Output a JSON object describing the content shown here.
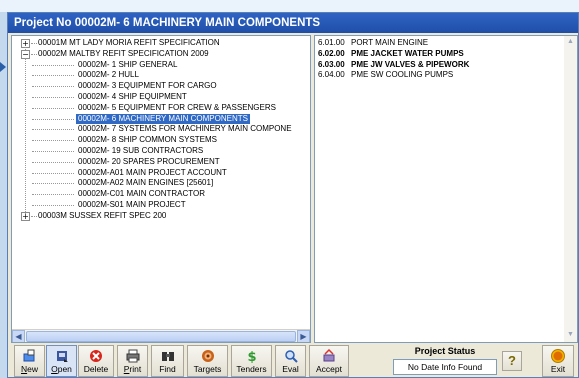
{
  "window": {
    "title": "Project No 00002M-  6  MACHINERY MAIN COMPONENTS"
  },
  "tree": {
    "nodes": [
      {
        "level": 0,
        "expander": "+",
        "label": "00001M  MT LADY MORIA REFIT SPECIFICATION"
      },
      {
        "level": 0,
        "expander": "−",
        "label": "00002M  MALTBY REFIT SPECIFICATION 2009"
      },
      {
        "level": 1,
        "label": "00002M-  1  SHIP GENERAL"
      },
      {
        "level": 1,
        "label": "00002M-  2  HULL"
      },
      {
        "level": 1,
        "label": "00002M-  3  EQUIPMENT FOR CARGO"
      },
      {
        "level": 1,
        "label": "00002M-  4  SHIP EQUIPMENT"
      },
      {
        "level": 1,
        "label": "00002M-  5  EQUIPMENT FOR CREW & PASSENGERS"
      },
      {
        "level": 1,
        "label": "00002M-  6  MACHINERY MAIN COMPONENTS",
        "selected": true
      },
      {
        "level": 1,
        "label": "00002M-  7  SYSTEMS FOR MACHINERY MAIN COMPONE"
      },
      {
        "level": 1,
        "label": "00002M-  8  SHIP COMMON SYSTEMS"
      },
      {
        "level": 1,
        "label": "00002M- 19  SUB CONTRACTORS"
      },
      {
        "level": 1,
        "label": "00002M- 20  SPARES PROCUREMENT"
      },
      {
        "level": 1,
        "label": "00002M-A01  MAIN PROJECT ACCOUNT"
      },
      {
        "level": 1,
        "label": "00002M-A02  MAIN ENGINES [25601]"
      },
      {
        "level": 1,
        "label": "00002M-C01  MAIN CONTRACTOR"
      },
      {
        "level": 1,
        "label": "00002M-S01  MAIN PROJECT"
      },
      {
        "level": 0,
        "expander": "+",
        "label": "00003M  SUSSEX REFIT SPEC 200"
      }
    ]
  },
  "details": {
    "rows": [
      {
        "code": "6.01.00",
        "desc": "PORT MAIN ENGINE",
        "bold": false
      },
      {
        "code": "6.02.00",
        "desc": "PME JACKET WATER PUMPS",
        "bold": true
      },
      {
        "code": "6.03.00",
        "desc": "PME JW VALVES & PIPEWORK",
        "bold": true
      },
      {
        "code": "6.04.00",
        "desc": "PME SW COOLING PUMPS",
        "bold": false
      }
    ]
  },
  "toolbar": {
    "buttons": [
      {
        "name": "new",
        "label": "New",
        "u": "N",
        "rest": "ew",
        "icon": "new-project-icon",
        "color": "#2b6fd6"
      },
      {
        "name": "open",
        "label": "Open",
        "u": "O",
        "rest": "pen",
        "icon": "open-icon",
        "color": "#3a56a0",
        "pressed": true
      },
      {
        "name": "delete",
        "label": "Delete",
        "u": "",
        "rest": "Delete",
        "icon": "delete-icon",
        "color": "#d9261c"
      },
      {
        "name": "print",
        "label": "Print",
        "u": "P",
        "rest": "rint",
        "icon": "printer-icon",
        "color": "#444444"
      },
      {
        "name": "find",
        "label": "Find",
        "u": "",
        "rest": "Find",
        "icon": "binoculars-icon",
        "color": "#333333"
      },
      {
        "name": "targets",
        "label": "Targets",
        "u": "",
        "rest": "Targets",
        "icon": "targets-icon",
        "color": "#c8621b"
      },
      {
        "name": "tenders",
        "label": "Tenders",
        "u": "",
        "rest": "Tenders",
        "icon": "tenders-icon",
        "color": "#2f9a2f"
      },
      {
        "name": "eval",
        "label": "Eval",
        "u": "",
        "rest": "Eval",
        "icon": "magnifier-icon",
        "color": "#2e5fb0"
      },
      {
        "name": "accept",
        "label": "Accept",
        "u": "",
        "rest": "Accept",
        "icon": "accept-icon",
        "color": "#7a5ca8"
      },
      {
        "name": "exit",
        "label": "Exit",
        "u": "",
        "rest": "Exit",
        "icon": "exit-icon",
        "color": "#e6a100"
      }
    ],
    "status_title": "Project Status",
    "status_value": "No Date Info Found",
    "help_glyph": "?",
    "exit_badge": "EXIT"
  },
  "colors": {
    "titlebar": "#2558b8",
    "selection": "#316ac5",
    "panel": "#ece9d8"
  }
}
